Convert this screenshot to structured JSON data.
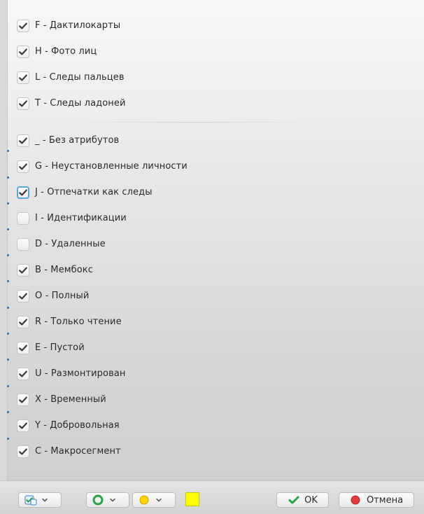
{
  "filters": {
    "group1": [
      {
        "label": "F - Дактилокарты",
        "checked": true
      },
      {
        "label": "H - Фото лиц",
        "checked": true
      },
      {
        "label": "L - Следы пальцев",
        "checked": true
      },
      {
        "label": "T - Следы ладоней",
        "checked": true
      }
    ],
    "group2": [
      {
        "label": "_ - Без атрибутов",
        "checked": true
      },
      {
        "label": "G - Неустановленные личности",
        "checked": true
      },
      {
        "label": "J - Отпечатки как следы",
        "checked": true,
        "focused": true
      },
      {
        "label": "I - Идентификации",
        "checked": false
      },
      {
        "label": "D - Удаленные",
        "checked": false
      },
      {
        "label": "B - Мембокс",
        "checked": true
      },
      {
        "label": "O - Полный",
        "checked": true
      },
      {
        "label": "R - Только чтение",
        "checked": true
      },
      {
        "label": "E - Пустой",
        "checked": true
      },
      {
        "label": "U - Размонтирован",
        "checked": true
      },
      {
        "label": "X - Временный",
        "checked": true
      },
      {
        "label": "Y - Добровольная",
        "checked": true
      },
      {
        "label": "C - Макросегмент",
        "checked": true
      }
    ]
  },
  "toolbar": {
    "ok_label": "OK",
    "cancel_label": "Отмена",
    "swatch_color": "#ffff00",
    "icons": [
      "checklist-icon",
      "circle-status-icon",
      "yellow-dot-icon",
      "ok-check-icon",
      "cancel-icon",
      "chevron-down-icon"
    ]
  }
}
